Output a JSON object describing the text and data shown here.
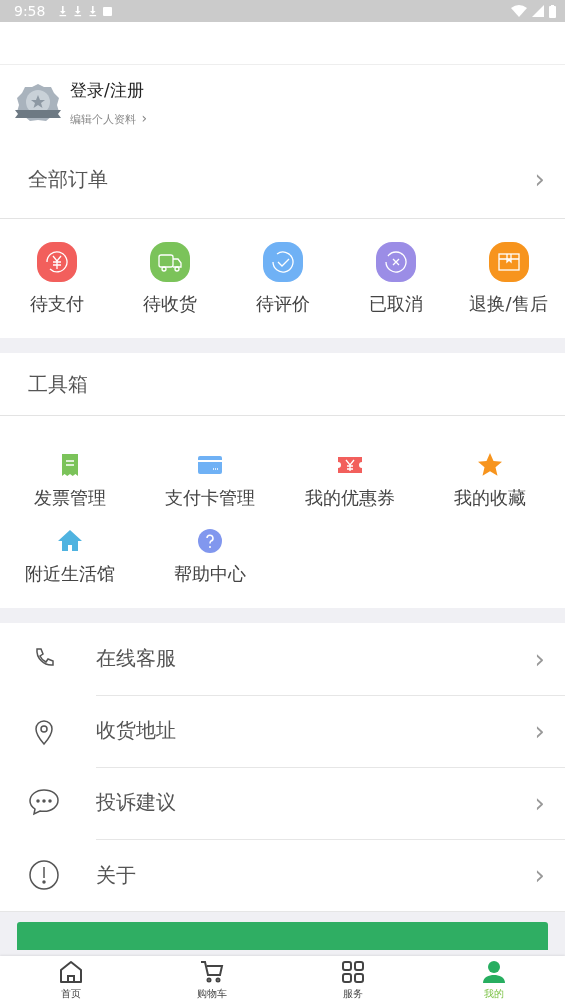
{
  "status_bar": {
    "time": "9:58"
  },
  "profile": {
    "name": "登录/注册",
    "edit_link": "编辑个人资料",
    "chevron": "›"
  },
  "orders": {
    "title": "全部订单",
    "chevron": "›",
    "items": [
      {
        "label": "待支付",
        "kind": "pay",
        "color": "#f25f5c"
      },
      {
        "label": "待收货",
        "kind": "truck",
        "color": "#7bc35a"
      },
      {
        "label": "待评价",
        "kind": "check",
        "color": "#6fb1f5"
      },
      {
        "label": "已取消",
        "kind": "cancel",
        "color": "#9b8de6"
      },
      {
        "label": "退换/售后",
        "kind": "box",
        "color": "#f7941d"
      }
    ]
  },
  "toolbox": {
    "title": "工具箱",
    "items": [
      {
        "label": "发票管理",
        "kind": "receipt"
      },
      {
        "label": "支付卡管理",
        "kind": "card"
      },
      {
        "label": "我的优惠券",
        "kind": "coupon"
      },
      {
        "label": "我的收藏",
        "kind": "star"
      },
      {
        "label": "附近生活馆",
        "kind": "house"
      },
      {
        "label": "帮助中心",
        "kind": "help"
      }
    ]
  },
  "menu": [
    {
      "label": "在线客服",
      "kind": "phone",
      "chevron": "›"
    },
    {
      "label": "收货地址",
      "kind": "pin",
      "chevron": "›"
    },
    {
      "label": "投诉建议",
      "kind": "chat",
      "chevron": "›"
    },
    {
      "label": "关于",
      "kind": "info",
      "chevron": "›"
    }
  ],
  "tab_bar": [
    {
      "label": "首页",
      "kind": "home",
      "selected": false
    },
    {
      "label": "购物车",
      "kind": "cart",
      "selected": false
    },
    {
      "label": "服务",
      "kind": "grid",
      "selected": false
    },
    {
      "label": "我的",
      "kind": "user",
      "selected": true
    }
  ]
}
